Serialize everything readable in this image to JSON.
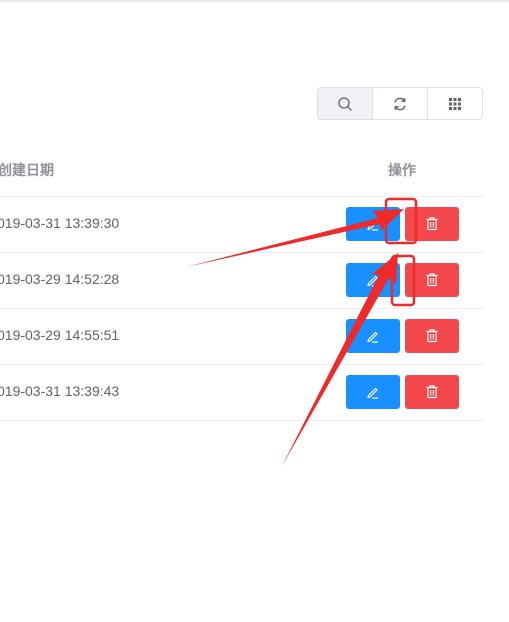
{
  "toolbar": {
    "buttons": [
      {
        "icon": "search-icon",
        "active": true
      },
      {
        "icon": "refresh-icon",
        "active": false
      },
      {
        "icon": "grid-icon",
        "active": false
      }
    ]
  },
  "table": {
    "headers": {
      "date": "创建日期",
      "action": "操作"
    },
    "rows": [
      {
        "date": "019-03-31 13:39:30"
      },
      {
        "date": "019-03-29 14:52:28"
      },
      {
        "date": "019-03-29 14:55:51"
      },
      {
        "date": "019-03-31 13:39:43"
      }
    ]
  },
  "colors": {
    "edit_button": "#1890ff",
    "delete_button": "#f5484c",
    "annotation": "#ee2a2a"
  }
}
